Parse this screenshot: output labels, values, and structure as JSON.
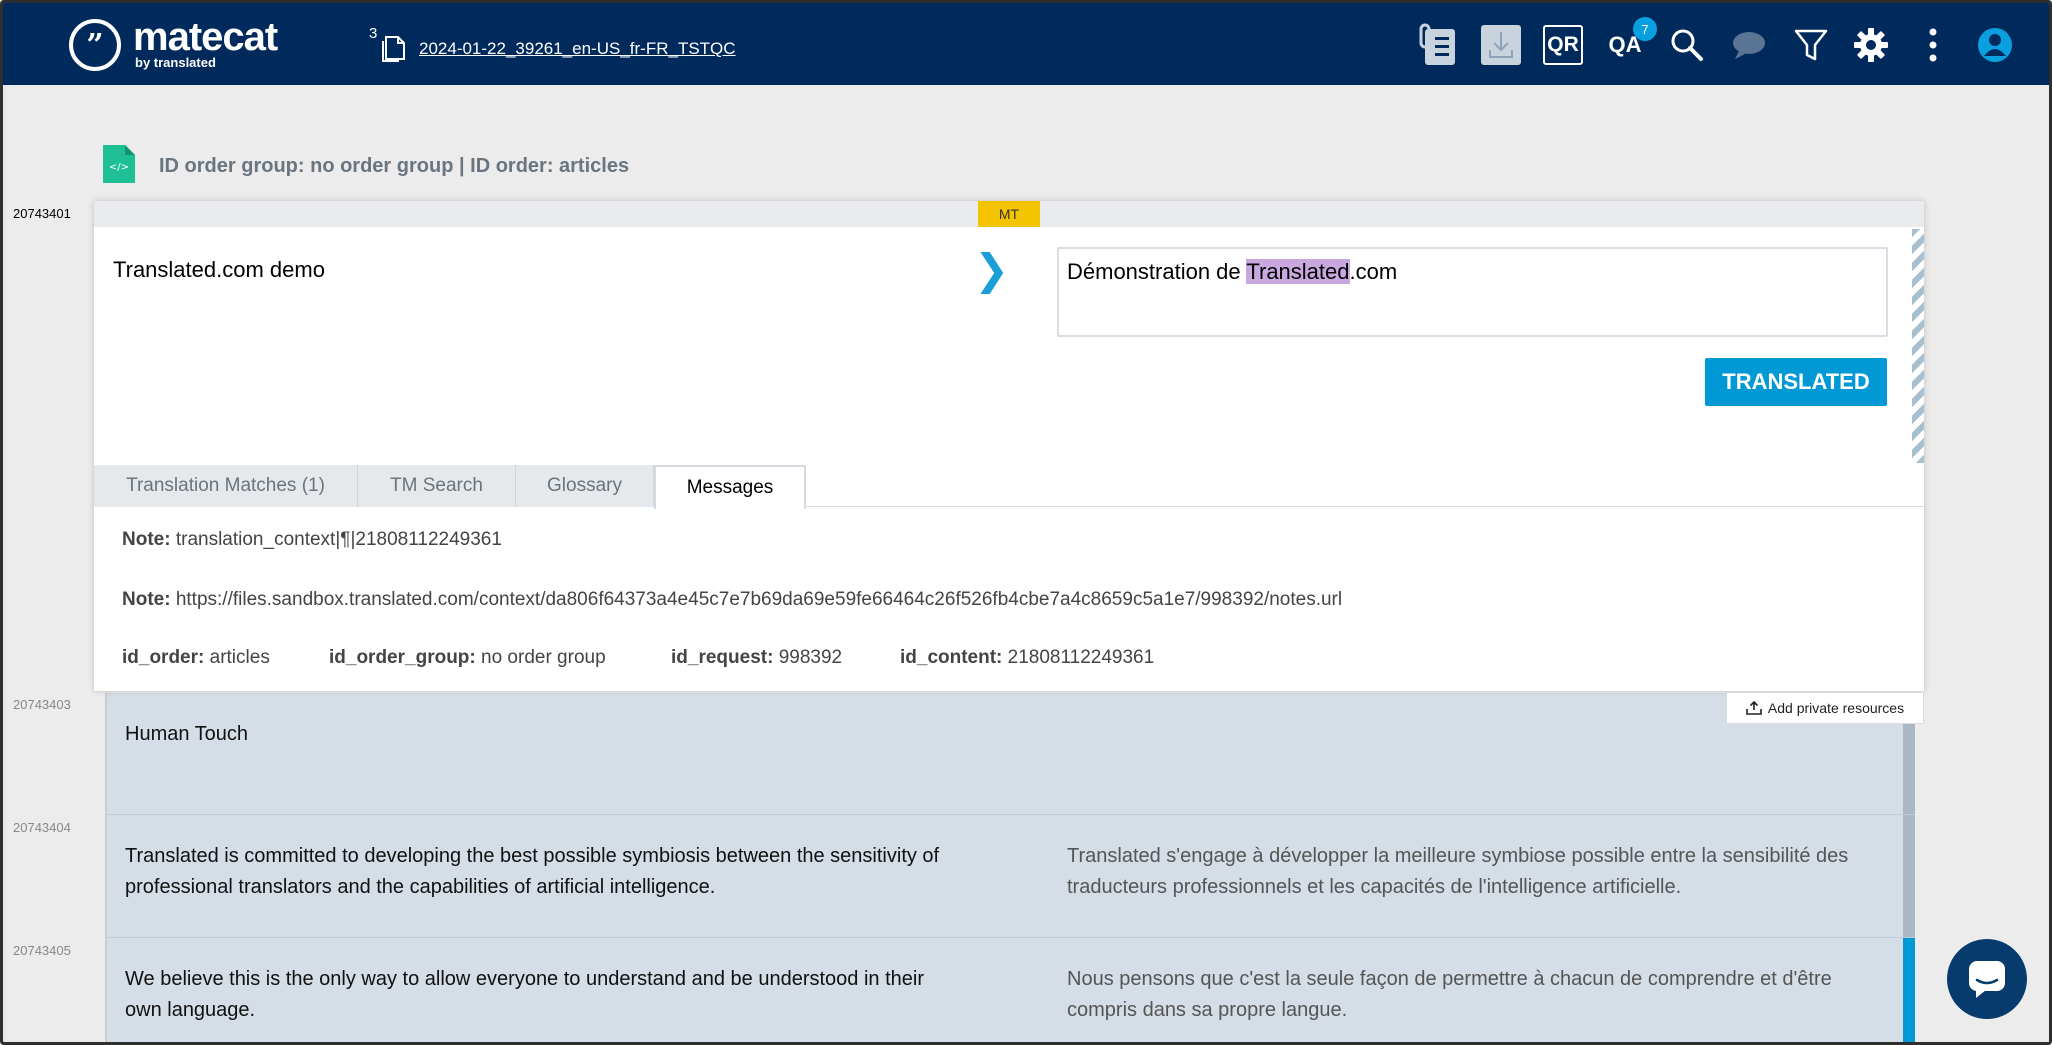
{
  "app": {
    "brand": "matecat",
    "brand_sub": "by translated",
    "logo_glyph": "”"
  },
  "job": {
    "count": "3",
    "name": "2024-01-22_39261_en-US_fr-FR_TSTQC"
  },
  "toolbar": {
    "qr_label": "QR",
    "qa_label": "QA",
    "qa_badge": "7",
    "icons": [
      "instructions-icon",
      "download-icon",
      "qr-icon",
      "qa-icon",
      "search-icon",
      "comments-icon",
      "filter-icon",
      "settings-icon",
      "more-icon",
      "user-icon"
    ]
  },
  "file_header": {
    "text": "ID order group: no order group | ID order: articles",
    "file_icon_glyph": "</>"
  },
  "active_segment": {
    "id": "20743401",
    "badge": "MT",
    "source": "Translated.com demo",
    "target_prefix": "Démonstration de ",
    "target_highlight": "Translated",
    "target_suffix": ".com",
    "status_button": "TRANSLATED",
    "tabs": [
      {
        "label": "Translation Matches (1)"
      },
      {
        "label": "TM Search"
      },
      {
        "label": "Glossary"
      },
      {
        "label": "Messages"
      }
    ],
    "notes": [
      {
        "label": "Note:",
        "value": " translation_context|¶|21808112249361"
      },
      {
        "label": "Note:",
        "value": " https://files.sandbox.translated.com/context/da806f64373a4e45c7e7b69da69e59fe66464c26f526fb4cbe7a4c8659c5a1e7/998392/notes.url"
      }
    ],
    "meta": [
      {
        "label": "id_order:",
        "value": " articles"
      },
      {
        "label": "id_order_group:",
        "value": " no order group"
      },
      {
        "label": "id_request:",
        "value": " 998392"
      },
      {
        "label": "id_content:",
        "value": " 21808112249361"
      }
    ],
    "add_resources": "Add private resources"
  },
  "segments": [
    {
      "id": "20743403",
      "source": "Human Touch",
      "target": ""
    },
    {
      "id": "20743404",
      "source": "Translated is committed to developing the best possible symbiosis between the sensitivity of professional translators and the capabilities of artificial intelligence.",
      "target": "Translated s'engage à développer la meilleure symbiose possible entre la sensibilité des traducteurs professionnels et les capacités de l'intelligence artificielle."
    },
    {
      "id": "20743405",
      "source": "We believe this is the only way to allow everyone to understand and be understood in their own language.",
      "target": "Nous pensons que c'est la seule façon de permettre à chacun de comprendre et d'être compris dans sa propre langue."
    }
  ],
  "colors": {
    "topbar": "#002a5c",
    "accent": "#0099d6",
    "mt_badge": "#f5c400",
    "highlight": "#c8a8df",
    "segment_bg": "#d5dde6"
  }
}
